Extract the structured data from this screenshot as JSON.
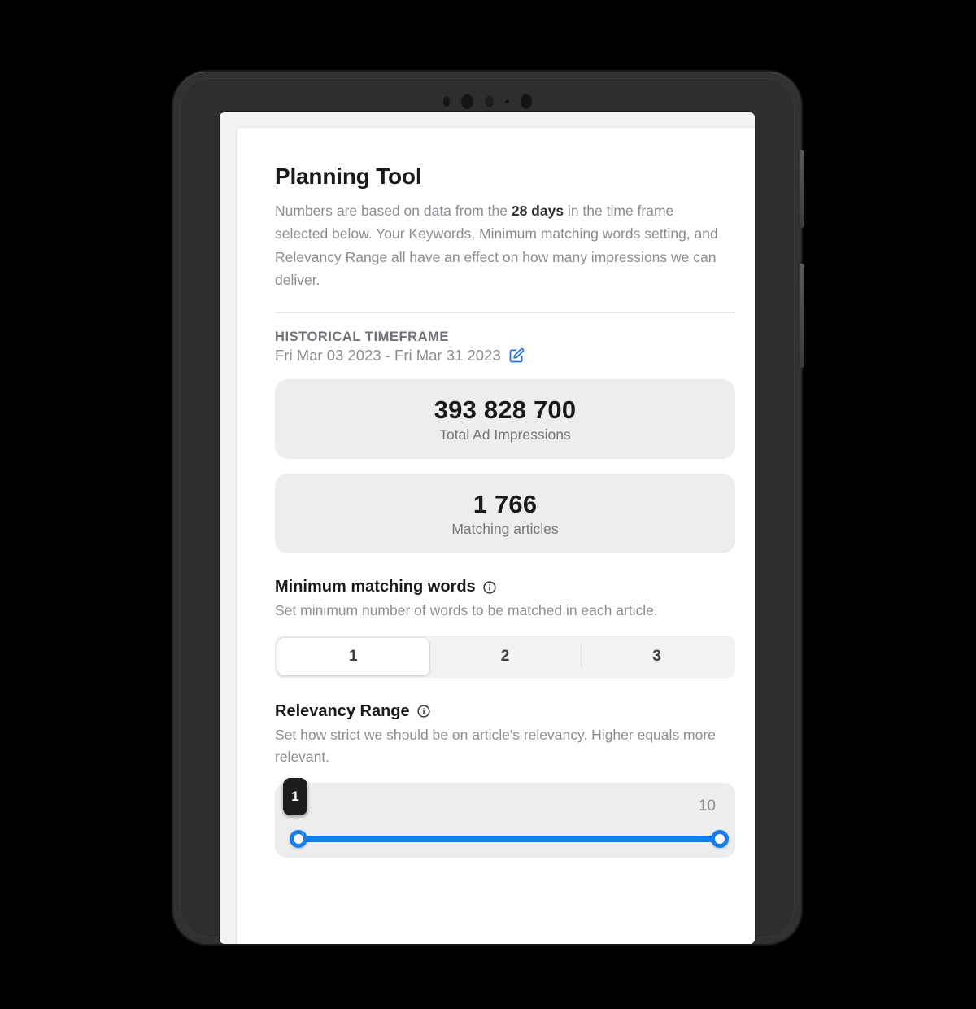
{
  "device": {
    "type": "tablet-frame",
    "sensors": [
      "proximity-sensor",
      "front-camera",
      "ambient-light-sensor",
      "microphone",
      "secondary-camera"
    ]
  },
  "page": {
    "title": "Planning Tool",
    "intro_part1": "Numbers are based on data from the ",
    "intro_bold": "28 days",
    "intro_part2": " in the time frame selected below. Your Keywords, Minimum matching words setting, and Relevancy Range all have an effect on how many impressions we can deliver."
  },
  "timeframe": {
    "eyebrow": "HISTORICAL TIMEFRAME",
    "range": "Fri Mar 03 2023 - Fri Mar 31 2023",
    "edit_icon": "edit-pencil-square-icon",
    "edit_icon_color": "#1f7ae0"
  },
  "stats": [
    {
      "value": "393 828 700",
      "label": "Total Ad Impressions"
    },
    {
      "value": "1 766",
      "label": "Matching articles"
    }
  ],
  "min_matching_words": {
    "title": "Minimum matching words",
    "info_icon": "info-circle-icon",
    "description": "Set minimum number of words to be matched in each article.",
    "options": [
      "1",
      "2",
      "3"
    ],
    "selected": "1"
  },
  "relevancy_range": {
    "title": "Relevancy Range",
    "info_icon": "info-circle-icon",
    "description": "Set how strict we should be on article's relevancy. Higher equals more relevant.",
    "min_value": "1",
    "max_value": "10",
    "accent_color": "#157ced"
  }
}
